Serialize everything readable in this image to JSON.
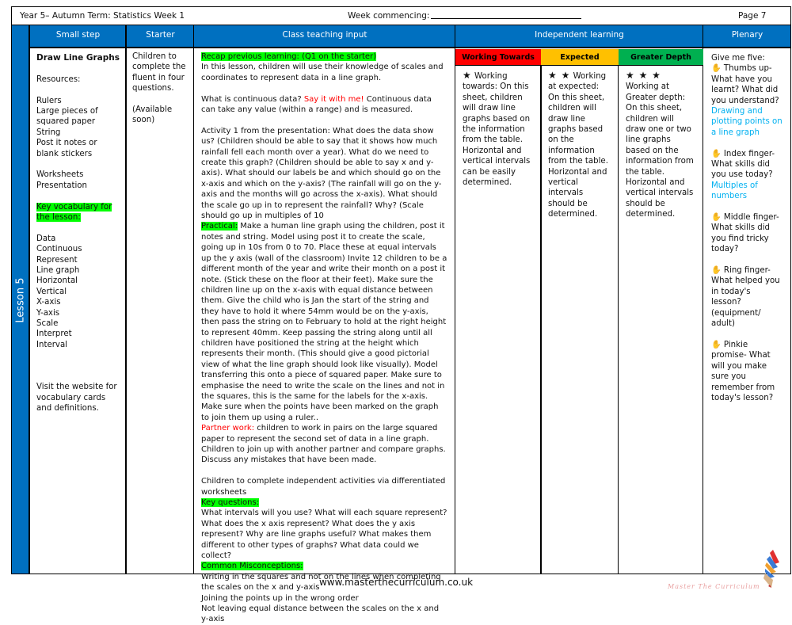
{
  "header": {
    "title": "Year 5– Autumn Term: Statistics  Week 1",
    "week_commencing_label": "Week commencing:",
    "page": "Page 7"
  },
  "lesson_label": "Lesson 5",
  "columns": {
    "small_step": "Small step",
    "starter": "Starter",
    "class_teaching": "Class teaching input",
    "independent": "Independent learning",
    "plenary": "Plenary"
  },
  "small_step": {
    "title": "Draw Line Graphs",
    "resources_label": "Resources:",
    "resources": [
      "Rulers",
      "Large pieces of squared paper",
      "String",
      "Post it notes or blank stickers"
    ],
    "materials": [
      "Worksheets",
      "Presentation"
    ],
    "vocab_label": "Key vocabulary for the lesson:",
    "vocab": [
      "Data",
      "Continuous",
      "Represent",
      "Line graph",
      "Horizontal",
      "Vertical",
      "X-axis",
      "Y-axis",
      "Scale",
      "Interpret",
      "Interval"
    ],
    "website_note": "Visit the website for vocabulary cards and definitions."
  },
  "starter": {
    "text": "Children to complete the fluent in four questions.",
    "availability": "(Available soon)"
  },
  "teaching": {
    "recap_label": "Recap previous learning: (Q1 on the starter)",
    "intro": "In this lesson, children will use their knowledge of scales and coordinates to represent data in a line graph.",
    "continuous_q": "What is continuous data? ",
    "say_it": "Say it with me!",
    "continuous_a": " Continuous data can take any value (within a range) and is measured.",
    "activity1": "Activity 1 from the presentation: What does the data show us? (Children should be able to say that it shows how much rainfall fell each month over a year). What do we need to create this graph? (Children should be able to say x and y-axis). What should our labels be and which should go on the x-axis and which on the y-axis? (The rainfall will go on the y-axis and the months will go across the x-axis). What should the scale go up in to represent the rainfall? Why? (Scale should go up in multiples of 10",
    "practical_label": "Practical:",
    "practical": " Make a human line graph using the children, post it notes and string. Model using post it to create the scale, going up in 10s from 0 to 70. Place these at equal intervals up the y axis (wall of the classroom) Invite 12 children to be a different month of the year and write their month on a post it note. (Stick these on the floor at their feet). Make sure the children line up on the x-axis with equal distance between them. Give the child who is Jan the start of the string and they have to hold it where 54mm would be on the y-axis, then pass the string on to February to hold at the right height to represent 40mm. Keep passing the string along until all children have positioned the string at the height which represents their month. (This should give a good pictorial view of what the line graph should look like visually). Model transferring this onto a piece of squared paper. Make sure to emphasise the need to write the scale on the lines and not in the squares, this is the same for the labels for the x-axis. Make sure when the points have been marked on the graph to join them up using a ruler..",
    "partner_label": "Partner work:",
    "partner": " children to work in pairs on the large squared paper to represent the second set of data in a line graph. Children to join up with another partner and compare graphs. Discuss any mistakes that have been made.",
    "independent_note": "Children to complete independent activities via differentiated worksheets",
    "key_questions_label": "Key questions:",
    "key_questions": "What intervals will you use? What will each square represent? What does the x axis represent? What does the y axis represent? Why are line graphs useful? What makes them different to other types of graphs? What data could we collect?",
    "misconceptions_label": "Common Misconceptions:",
    "misconceptions": [
      "Writing in the squares and not on the lines when completing the scales on the x and y-axis",
      "Joining the points up in the wrong order",
      "Not leaving equal distance between the scales on the x and y-axis"
    ]
  },
  "independent": [
    {
      "label": "Working Towards",
      "color": "#ff0000",
      "stars": "★",
      "text": " Working towards: On this sheet, children will draw line graphs based on the information from the table. Horizontal and vertical intervals can be easily determined."
    },
    {
      "label": "Expected",
      "color": "#ffc000",
      "stars": "★ ★",
      "text": " Working at expected: On this sheet, children will draw line graphs based on the information from the table. Horizontal and vertical intervals should be determined."
    },
    {
      "label": "Greater Depth",
      "color": "#00b050",
      "stars": "★ ★ ★",
      "text": " Working at Greater depth: On this sheet, children will draw one or two line graphs based on the information from the table. Horizontal and vertical intervals should be determined."
    }
  ],
  "plenary": {
    "intro": "Give me five:",
    "hand_icon": "✋",
    "items": [
      {
        "text": " Thumbs up- What have you learnt? What did you understand?",
        "answer": "Drawing and plotting points on a line graph"
      },
      {
        "text": " Index finger- What skills did you use today?",
        "answer": "Multiples of numbers"
      },
      {
        "text": " Middle finger- What skills did you find tricky today?",
        "answer": ""
      },
      {
        "text": " Ring finger- What helped you in today's lesson? (equipment/ adult)",
        "answer": ""
      },
      {
        "text": " Pinkie promise- What will you make sure you remember from today's lesson?",
        "answer": ""
      }
    ]
  },
  "footer": {
    "url": "www.masterthecurriculum.co.uk",
    "brand": "Master The Curriculum"
  },
  "colors": {
    "header_blue": "#0070c0",
    "highlight_green": "#00ff00",
    "emphasis_red": "#ff0000",
    "answer_blue": "#00b0f0"
  }
}
